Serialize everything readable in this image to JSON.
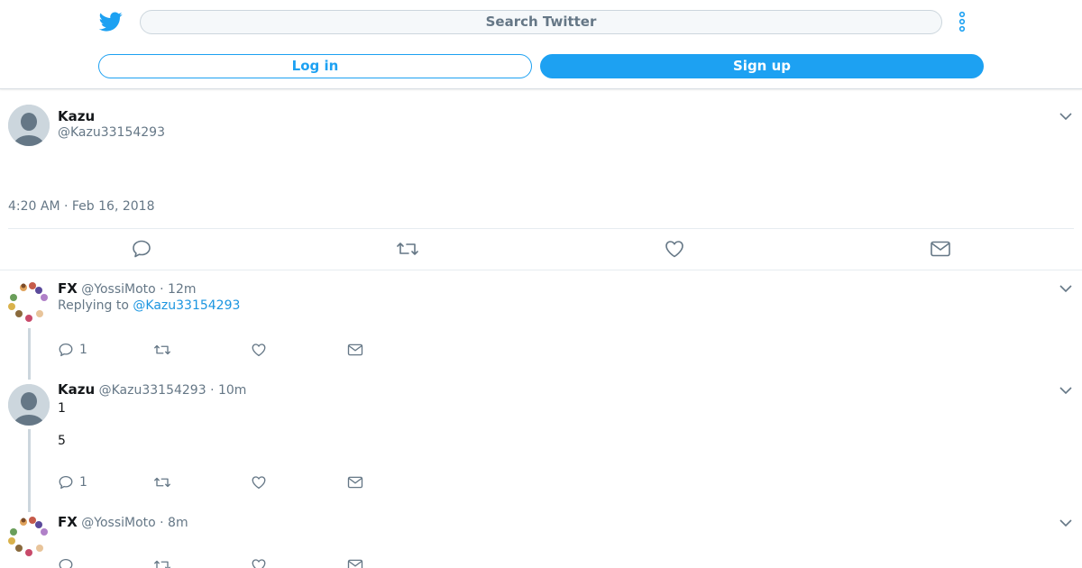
{
  "header": {
    "search_placeholder": "Search Twitter",
    "login_label": "Log in",
    "signup_label": "Sign up"
  },
  "main_tweet": {
    "name": "Kazu",
    "handle": "@Kazu33154293",
    "timestamp": "4:20 AM · Feb 16, 2018"
  },
  "replies": [
    {
      "name": "FX",
      "handle": "@YossiMoto",
      "time": "· 12m",
      "replying_prefix": "Replying to",
      "replying_to": "@Kazu33154293",
      "reply_count": "1"
    },
    {
      "name": "Kazu",
      "handle": "@Kazu33154293",
      "time": "· 10m",
      "text_line1": "1",
      "text_line2": "5",
      "reply_count": "1"
    },
    {
      "name": "FX",
      "handle": "@YossiMoto",
      "time": "· 8m"
    }
  ],
  "colors": {
    "brand": "#1da1f2",
    "link": "#1b95e0",
    "muted": "#657786",
    "icon": "#657786"
  },
  "icons": {
    "logo": "twitter-bird-icon",
    "more": "more-vertical-icon",
    "reply": "reply-icon",
    "retweet": "retweet-icon",
    "like": "heart-icon",
    "dm": "envelope-icon",
    "caret": "chevron-down-icon"
  }
}
